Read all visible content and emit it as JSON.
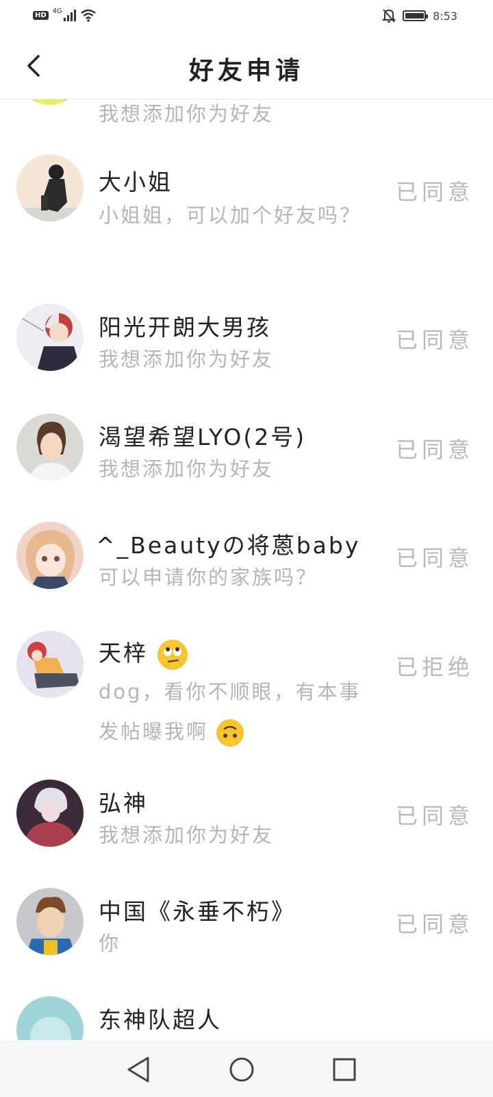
{
  "status_bar": {
    "hd": "HD",
    "network": "4G",
    "time": "8:53",
    "icons": [
      "hd-icon",
      "signal-icon",
      "wifi-icon",
      "mute-bell-icon",
      "battery-icon"
    ],
    "battery_level": 0.9
  },
  "header": {
    "title": "好友申请",
    "back_icon": "chevron-left-icon"
  },
  "requests": [
    {
      "name": "",
      "message": "我想添加你为好友",
      "status": "",
      "avatar_color": "#d8c0e6"
    },
    {
      "name": "大小姐",
      "message": "小姐姐，可以加个好友吗？",
      "status": "已同意",
      "avatar_color": "#f6e6d6"
    },
    {
      "name": "阳光开朗大男孩",
      "message": "我想添加你为好友",
      "status": "已同意",
      "avatar_color": "#e8e8ee"
    },
    {
      "name": "渴望希望LYO(2号)",
      "message": "我想添加你为好友",
      "status": "已同意",
      "avatar_color": "#dcdad6"
    },
    {
      "name": "^_Beautyの将蒽baby",
      "message": "可以申请你的家族吗？",
      "status": "已同意",
      "avatar_color": "#f0d4c8"
    },
    {
      "name": "天梓",
      "name_emoji": "eye-roll-emoji",
      "message": "dog，看你不顺眼，有本事发帖曝我啊",
      "message_emoji": "upside-down-face-emoji",
      "status": "已拒绝",
      "avatar_color": "#e6e2ee"
    },
    {
      "name": "弘神",
      "message": "我想添加你为好友",
      "status": "已同意",
      "avatar_color": "#8a4a5a"
    },
    {
      "name": "中国《永垂不朽》",
      "message": "你",
      "status": "已同意",
      "avatar_color": "#c8c8cc"
    },
    {
      "name": "东神队超人",
      "message": "",
      "status": "",
      "avatar_color": "#9fd4d8"
    }
  ],
  "nav_bar": {
    "back": "triangle-back-icon",
    "home": "circle-home-icon",
    "recents": "square-recents-icon"
  }
}
